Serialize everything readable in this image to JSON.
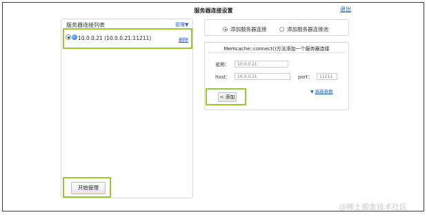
{
  "header": {
    "title": "服务器连接设置",
    "logout_label": "退出"
  },
  "left_panel": {
    "title": "服务器连接列表",
    "manage_label": "管理▼",
    "servers": [
      {
        "name": "10.0.0.21",
        "address": "(10.0.0.21:11211)",
        "delete_label": "删除"
      }
    ],
    "start_button_label": "开始管理"
  },
  "mode": {
    "options": [
      {
        "label": "添加服务器连接",
        "selected": true
      },
      {
        "label": "添加服务器连接池",
        "selected": false
      }
    ]
  },
  "form": {
    "title": "Memcache::connect()方法添加一个服务器连接",
    "name_label": "名称：",
    "name_placeholder": "10.0.0.21",
    "host_label": "host：",
    "host_placeholder": "10.0.0.21",
    "port_label": "port：",
    "port_placeholder": "11211",
    "advanced_label": "高级参数",
    "advanced_icon": "triangle-down-icon",
    "add_button_label": "< 添加"
  },
  "watermark": "@稀土掘金技术社区",
  "colors": {
    "highlight_border": "#9ac53b",
    "link": "#1a5fb4"
  }
}
